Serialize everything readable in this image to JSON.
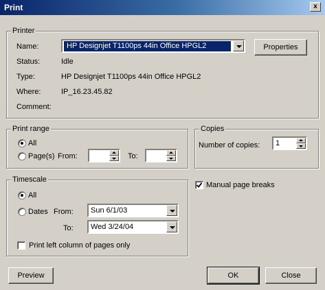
{
  "window": {
    "title": "Print",
    "close_glyph": "x"
  },
  "printer": {
    "legend": "Printer",
    "name_label": "Name:",
    "name_value": "HP Designjet T1100ps 44in Office HPGL2",
    "properties_button": "Properties",
    "status_label": "Status:",
    "status_value": "Idle",
    "type_label": "Type:",
    "type_value": "HP Designjet T1100ps 44in Office HPGL2",
    "where_label": "Where:",
    "where_value": "IP_16.23.45.82",
    "comment_label": "Comment:"
  },
  "print_range": {
    "legend": "Print range",
    "all_label": "All",
    "all_selected": true,
    "pages_label": "Page(s)",
    "from_label": "From:",
    "from_value": "",
    "to_label": "To:",
    "to_value": ""
  },
  "copies": {
    "legend": "Copies",
    "number_label": "Number of copies:",
    "number_value": "1"
  },
  "timescale": {
    "legend": "Timescale",
    "all_label": "All",
    "all_selected": true,
    "dates_label": "Dates",
    "from_label": "From:",
    "from_value": "Sun 6/1/03",
    "to_label": "To:",
    "to_value": "Wed 3/24/04",
    "left_column_label": "Print left column of pages only",
    "left_column_checked": false
  },
  "manual_page_breaks": {
    "label": "Manual page breaks",
    "checked": true
  },
  "buttons": {
    "preview": "Preview",
    "ok": "OK",
    "close": "Close"
  }
}
